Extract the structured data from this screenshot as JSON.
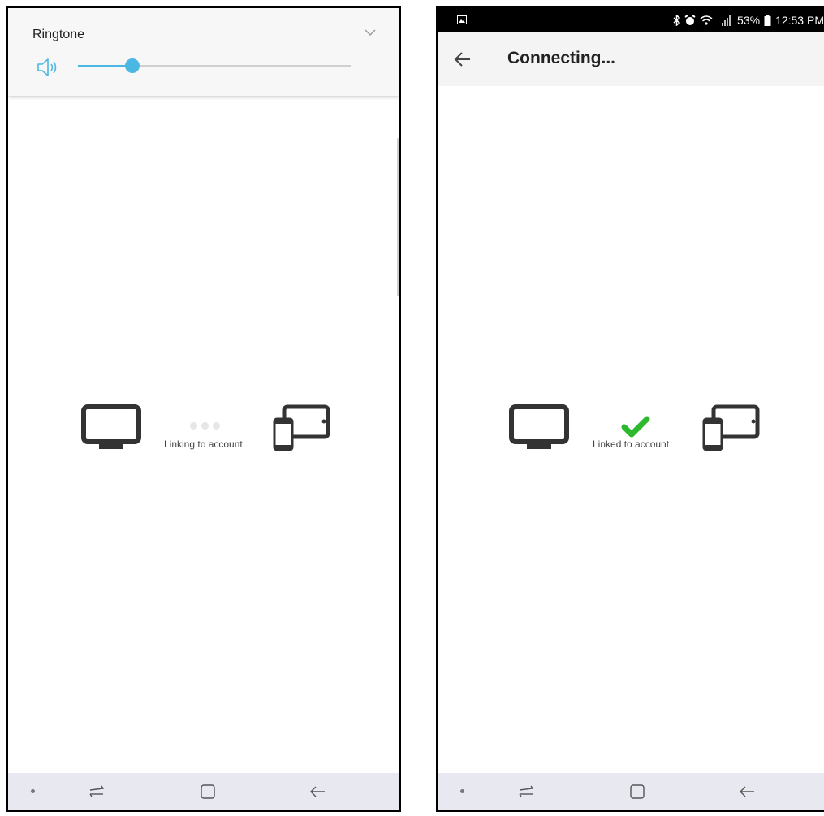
{
  "left_screen": {
    "volume_panel": {
      "label": "Ringtone",
      "level_percent": 20,
      "accent_color": "#4bb8e3"
    },
    "linking": {
      "caption": "Linking to account",
      "state": "in-progress"
    }
  },
  "right_screen": {
    "status_bar": {
      "battery": "53%",
      "time": "12:53 PM"
    },
    "app_bar": {
      "title": "Connecting..."
    },
    "linking": {
      "caption": "Linked to account",
      "state": "linked",
      "check_color": "#2db82d"
    }
  },
  "icons": [
    "speaker-icon",
    "chevron-down-icon",
    "monitor-icon",
    "tablet-phone-icon",
    "loading-dots-icon",
    "checkmark-icon",
    "back-arrow-icon",
    "bluetooth-icon",
    "alarm-icon",
    "wifi-icon",
    "signal-icon",
    "battery-icon",
    "gallery-icon",
    "recents-icon",
    "home-icon",
    "nav-back-icon"
  ]
}
